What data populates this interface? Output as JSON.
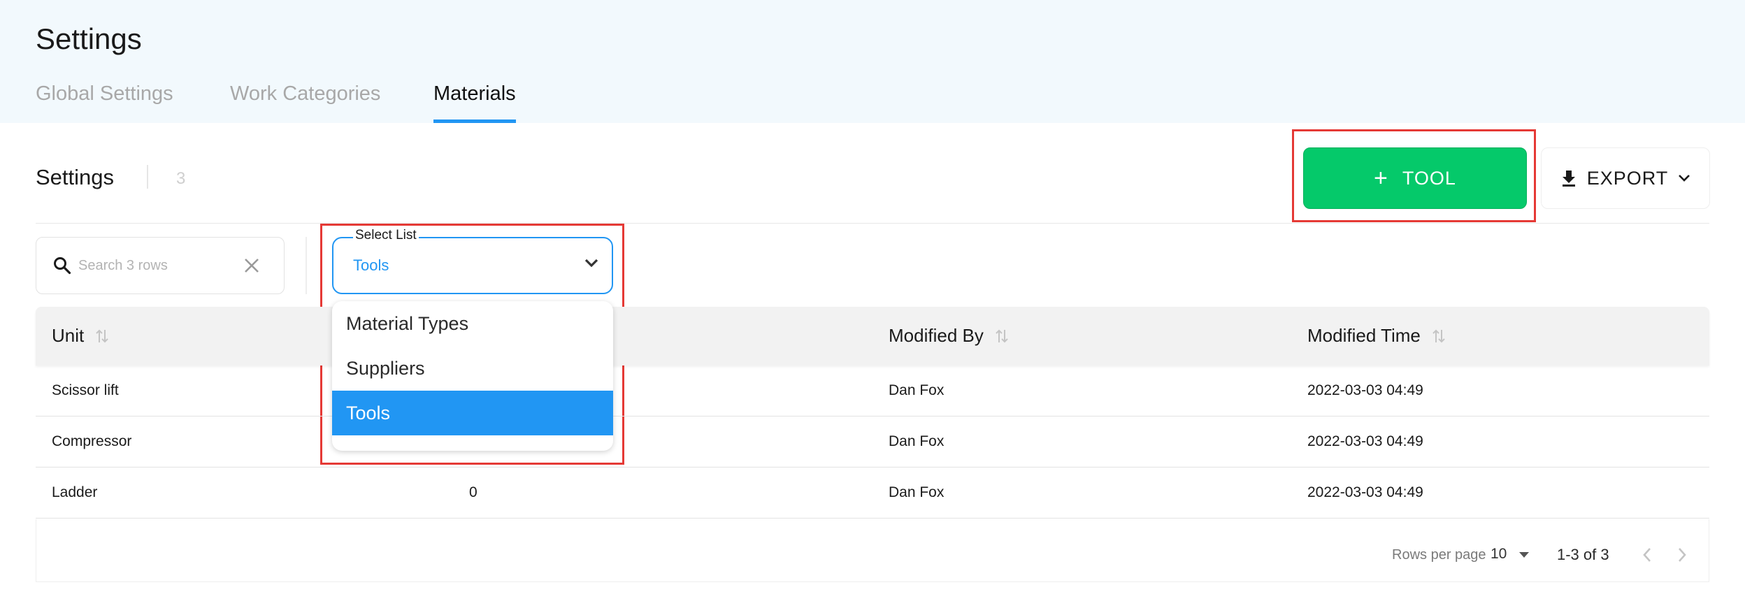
{
  "header": {
    "title": "Settings",
    "tabs": [
      {
        "label": "Global Settings"
      },
      {
        "label": "Work Categories"
      },
      {
        "label": "Materials"
      }
    ]
  },
  "toolbar": {
    "section_title": "Settings",
    "count": "3",
    "add_button_label": "TOOL",
    "export_label": "EXPORT"
  },
  "search": {
    "placeholder": "Search 3 rows",
    "value": ""
  },
  "select": {
    "label": "Select List",
    "value": "Tools",
    "options": [
      "Material Types",
      "Suppliers",
      "Tools"
    ],
    "selected_index": 2
  },
  "table": {
    "columns": [
      "Unit",
      "Modified By",
      "Modified Time"
    ],
    "rows": [
      {
        "unit": "Scissor lift",
        "count": "",
        "modified_by": "Dan Fox",
        "modified_time": "2022-03-03 04:49"
      },
      {
        "unit": "Compressor",
        "count": "",
        "modified_by": "Dan Fox",
        "modified_time": "2022-03-03 04:49"
      },
      {
        "unit": "Ladder",
        "count": "0",
        "modified_by": "Dan Fox",
        "modified_time": "2022-03-03 04:49"
      }
    ]
  },
  "pagination": {
    "rows_per_page_label": "Rows per page",
    "rows_per_page": "10",
    "range": "1-3 of 3"
  },
  "colors": {
    "accent": "#2196f3",
    "primary_button": "#05c96a",
    "highlight": "#e53935",
    "header_bg": "#f2f9fd"
  }
}
